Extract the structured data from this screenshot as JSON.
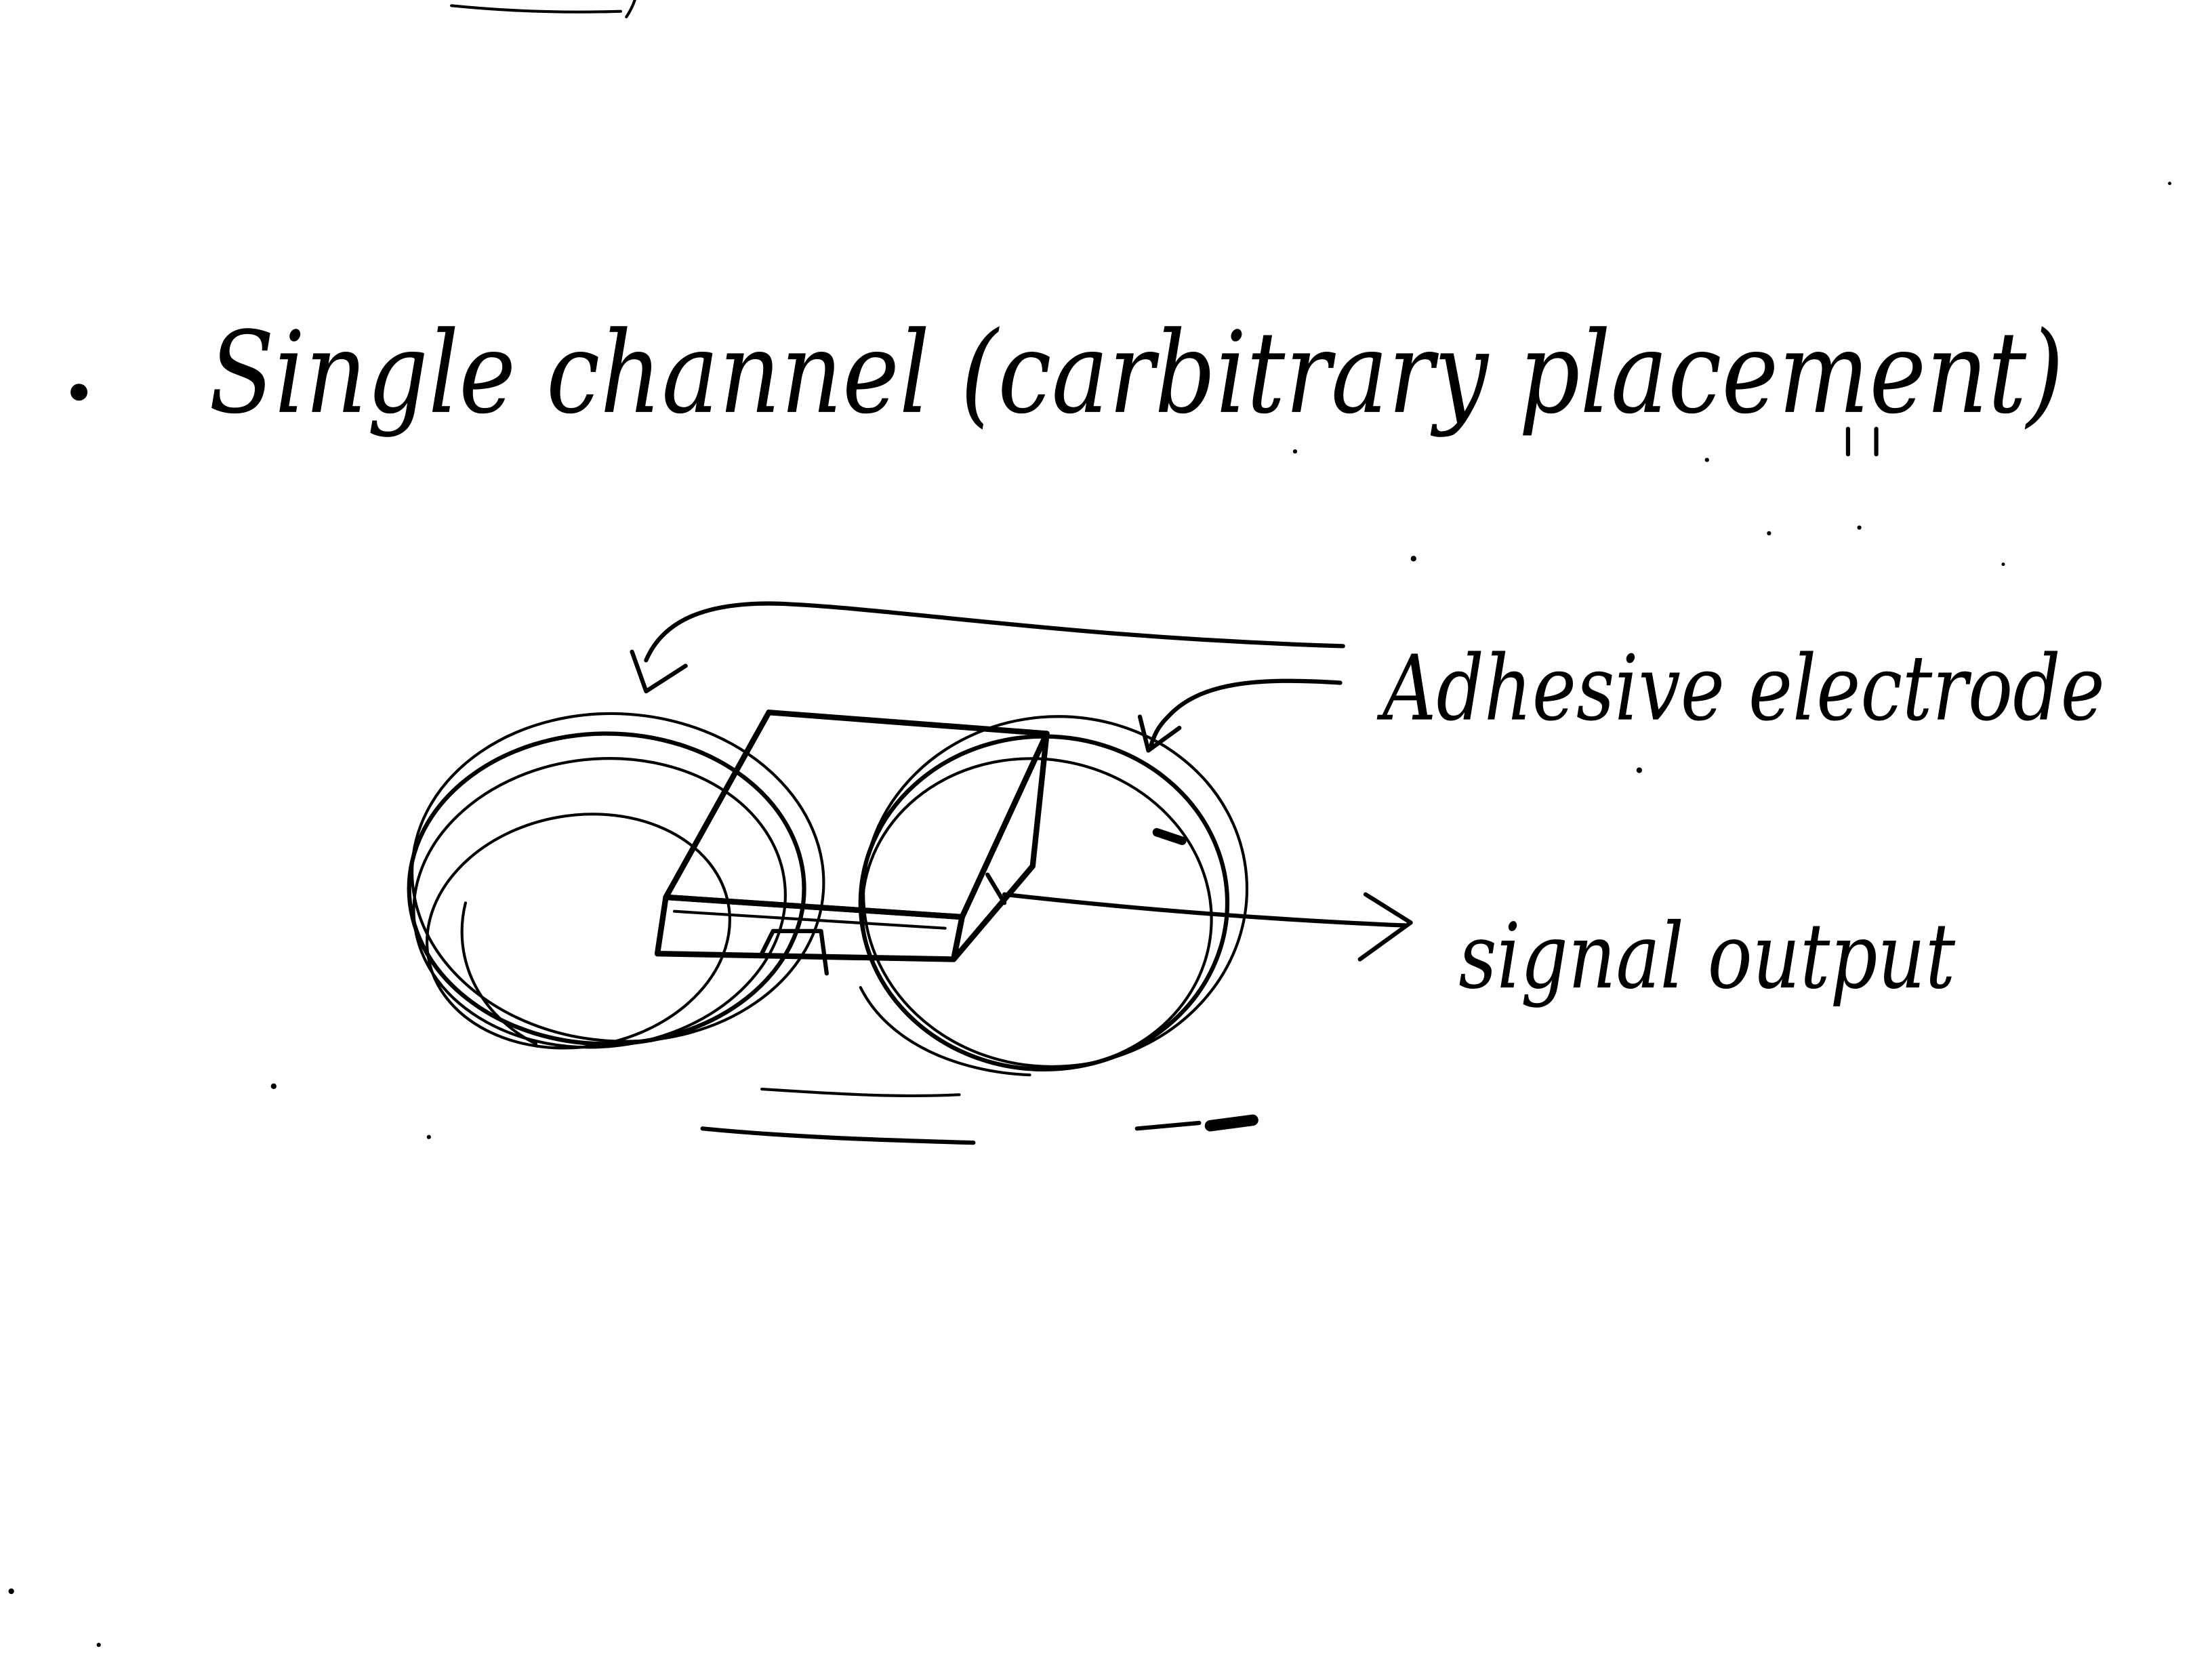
{
  "note": {
    "heading": "Single channel (carbitrary placement)",
    "labels": {
      "electrode": "Adhesive electrode",
      "output": "signal output"
    }
  },
  "ink_color": "#000000",
  "paper_color": "#ffffff"
}
